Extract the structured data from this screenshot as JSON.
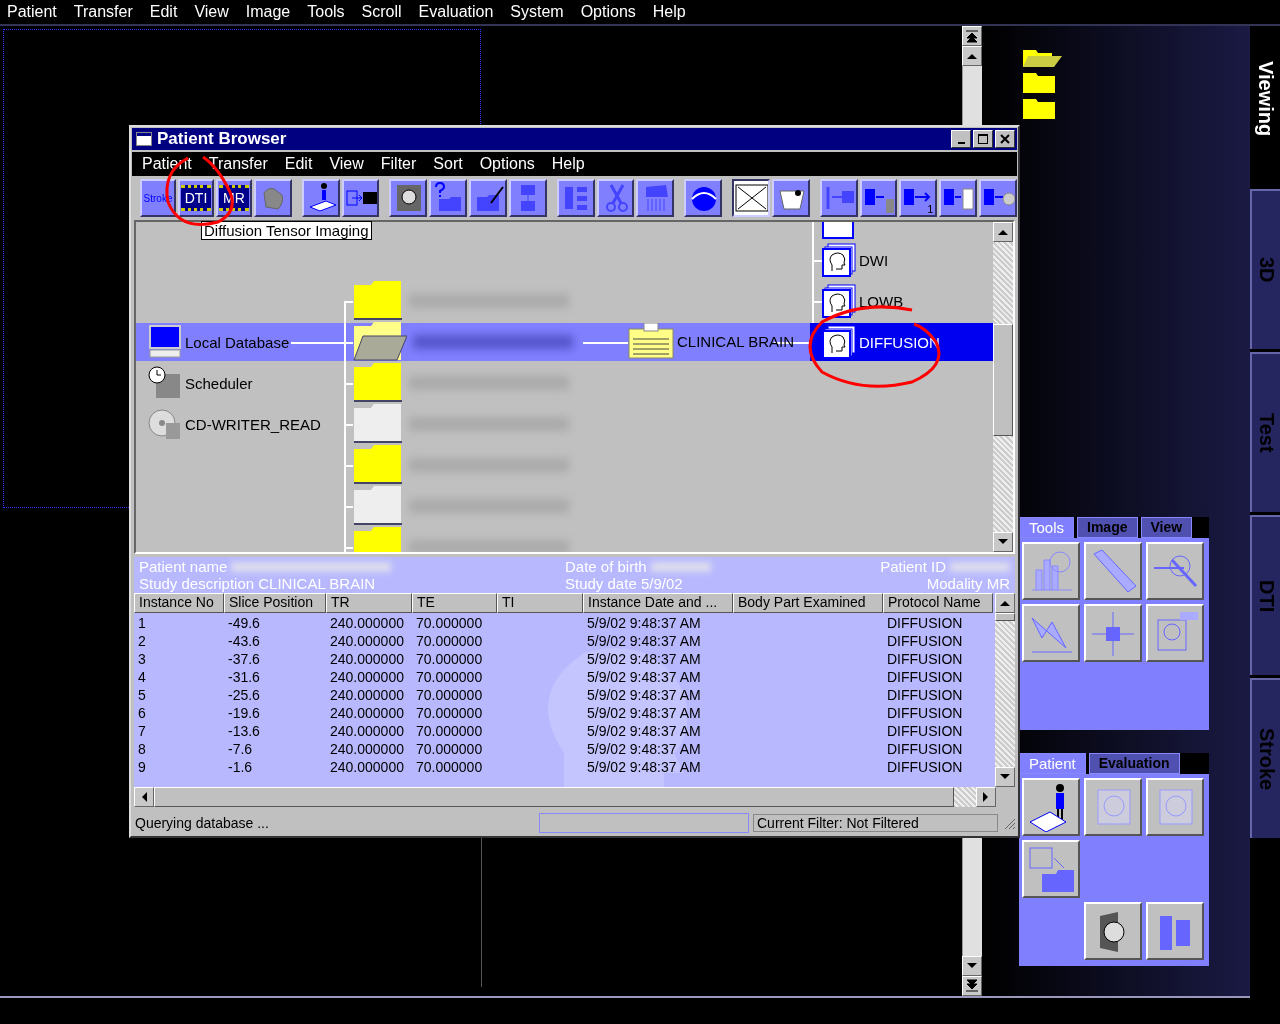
{
  "menubar": [
    "Patient",
    "Transfer",
    "Edit",
    "View",
    "Image",
    "Tools",
    "Scroll",
    "Evaluation",
    "System",
    "Options",
    "Help"
  ],
  "side_tabs": [
    {
      "label": "Viewing",
      "selected": true
    },
    {
      "label": "3D",
      "selected": false
    },
    {
      "label": "Test",
      "selected": false
    },
    {
      "label": "DTI",
      "selected": false
    },
    {
      "label": "Stroke",
      "selected": false
    }
  ],
  "tools_panel": {
    "tabs": [
      {
        "label": "Tools",
        "selected": true
      },
      {
        "label": "Image",
        "selected": false
      },
      {
        "label": "View",
        "selected": false
      }
    ]
  },
  "patient_panel": {
    "tabs": [
      {
        "label": "Patient",
        "selected": true
      },
      {
        "label": "Evaluation",
        "selected": false
      }
    ]
  },
  "window": {
    "title": "Patient Browser",
    "menu": [
      "Patient",
      "Transfer",
      "Edit",
      "View",
      "Filter",
      "Sort",
      "Options",
      "Help"
    ],
    "toolbar": [
      {
        "kind": "text",
        "label": "Stroke",
        "gap": false
      },
      {
        "kind": "chip",
        "label": "DTI",
        "gap": false
      },
      {
        "kind": "chip",
        "label": "MR",
        "gap": false
      },
      {
        "kind": "icon",
        "gap": false
      },
      {
        "kind": "icon",
        "gap": true
      },
      {
        "kind": "icon",
        "gap": false
      },
      {
        "kind": "icon",
        "gap": true
      },
      {
        "kind": "icon",
        "gap": false
      },
      {
        "kind": "icon",
        "gap": false
      },
      {
        "kind": "icon",
        "gap": false
      },
      {
        "kind": "icon",
        "gap": true
      },
      {
        "kind": "icon",
        "gap": false
      },
      {
        "kind": "icon",
        "gap": false
      },
      {
        "kind": "icon",
        "gap": true
      },
      {
        "kind": "icon",
        "gap": true
      },
      {
        "kind": "icon",
        "gap": false
      },
      {
        "kind": "icon",
        "gap": true
      },
      {
        "kind": "icon",
        "gap": false
      },
      {
        "kind": "icon",
        "gap": false,
        "label": "1"
      },
      {
        "kind": "icon",
        "gap": false
      },
      {
        "kind": "icon",
        "gap": false
      }
    ],
    "tooltip": "Diffusion Tensor Imaging",
    "tree": {
      "sources": [
        {
          "label": "Local Database",
          "selected": true
        },
        {
          "label": "Scheduler",
          "selected": false
        },
        {
          "label": "CD-WRITER_READ",
          "selected": false
        }
      ],
      "patients": [
        {
          "selected": false
        },
        {
          "selected": true
        },
        {
          "selected": false
        },
        {
          "selected": false
        },
        {
          "selected": false
        },
        {
          "selected": false
        },
        {
          "selected": false
        }
      ],
      "study": {
        "label": "CLINICAL BRAIN"
      },
      "series": [
        {
          "label": "DWI",
          "selected": false
        },
        {
          "label": "LOWB",
          "selected": false
        },
        {
          "label": "DIFFUSION",
          "selected": true
        }
      ]
    },
    "info": {
      "patient_name_label": "Patient name",
      "date_of_birth_label": "Date of birth",
      "patient_id_label": "Patient ID",
      "study_description": "Study description CLINICAL BRAIN",
      "study_date": "Study date 5/9/02",
      "modality": "Modality MR"
    },
    "table": {
      "columns": [
        "Instance No",
        "Slice Position",
        "TR",
        "TE",
        "TI",
        "Instance Date and ...",
        "Body Part Examined",
        "Protocol Name"
      ],
      "rows": [
        [
          "1",
          "-49.6",
          "240.000000",
          "70.000000",
          null,
          "5/9/02 9:48:37 AM",
          null,
          "DIFFUSION"
        ],
        [
          "2",
          "-43.6",
          "240.000000",
          "70.000000",
          null,
          "5/9/02 9:48:37 AM",
          null,
          "DIFFUSION"
        ],
        [
          "3",
          "-37.6",
          "240.000000",
          "70.000000",
          null,
          "5/9/02 9:48:37 AM",
          null,
          "DIFFUSION"
        ],
        [
          "4",
          "-31.6",
          "240.000000",
          "70.000000",
          null,
          "5/9/02 9:48:37 AM",
          null,
          "DIFFUSION"
        ],
        [
          "5",
          "-25.6",
          "240.000000",
          "70.000000",
          null,
          "5/9/02 9:48:37 AM",
          null,
          "DIFFUSION"
        ],
        [
          "6",
          "-19.6",
          "240.000000",
          "70.000000",
          null,
          "5/9/02 9:48:37 AM",
          null,
          "DIFFUSION"
        ],
        [
          "7",
          "-13.6",
          "240.000000",
          "70.000000",
          null,
          "5/9/02 9:48:37 AM",
          null,
          "DIFFUSION"
        ],
        [
          "8",
          "-7.6",
          "240.000000",
          "70.000000",
          null,
          "5/9/02 9:48:37 AM",
          null,
          "DIFFUSION"
        ],
        [
          "9",
          "-1.6",
          "240.000000",
          "70.000000",
          null,
          "5/9/02 9:48:37 AM",
          null,
          "DIFFUSION"
        ]
      ]
    },
    "status": {
      "message": "Querying database ...",
      "filter": "Current Filter: Not Filtered"
    }
  }
}
